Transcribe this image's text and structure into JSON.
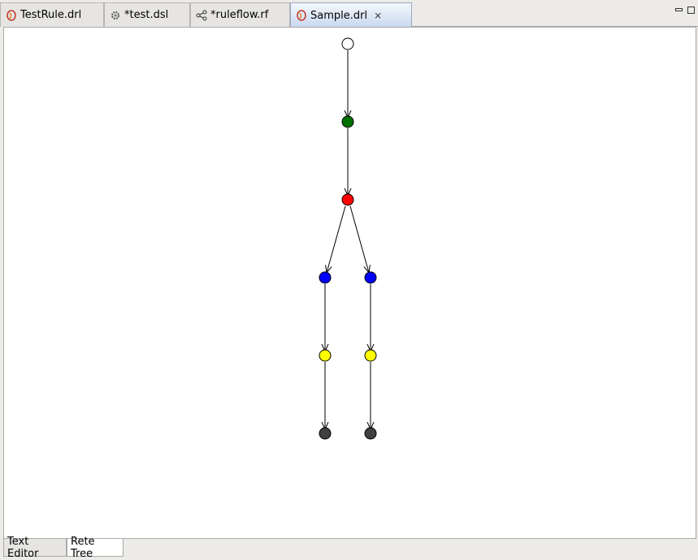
{
  "tabs": [
    {
      "label": "TestRule.drl",
      "icon": "drools-file-icon"
    },
    {
      "label": "*test.dsl",
      "icon": "gear-icon"
    },
    {
      "label": "*ruleflow.rf",
      "icon": "ruleflow-icon"
    },
    {
      "label": "Sample.drl",
      "icon": "drools-file-icon",
      "active": true
    }
  ],
  "bottom_tabs": [
    "Text Editor",
    "Rete Tree"
  ],
  "graph": {
    "node_colors": {
      "root": "#ffffff",
      "object_type": "#007000",
      "alpha": "#ff0000",
      "left_input": "#0000ff",
      "join": "#ffff00",
      "terminal": "#404040"
    },
    "edge_color": "#000000"
  }
}
